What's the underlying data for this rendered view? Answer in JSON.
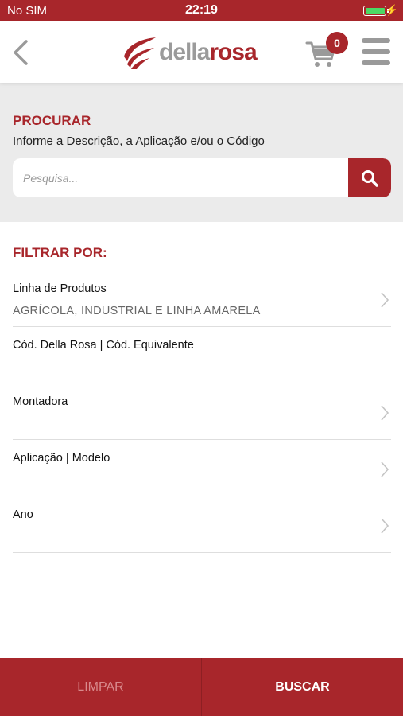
{
  "status_bar": {
    "carrier": "No SIM",
    "time": "22:19",
    "battery_level": 1.0
  },
  "header": {
    "logo_della": "della",
    "logo_rosa": "rosa",
    "cart_count": "0",
    "icons": {
      "back": "chevron-left-icon",
      "cart": "cart-icon",
      "menu": "hamburger-menu-icon"
    }
  },
  "search": {
    "title": "PROCURAR",
    "subtitle": "Informe a Descrição, a Aplicação e/ou o Código",
    "placeholder": "Pesquisa..."
  },
  "filters": {
    "title": "FILTRAR POR:",
    "items": [
      {
        "label": "Linha de Produtos",
        "value": "AGRÍCOLA, INDUSTRIAL E LINHA AMARELA",
        "has_chevron": true
      },
      {
        "label": "Cód. Della Rosa | Cód. Equivalente",
        "value": "",
        "has_chevron": false
      },
      {
        "label": "Montadora",
        "value": "",
        "has_chevron": true
      },
      {
        "label": "Aplicação | Modelo",
        "value": "",
        "has_chevron": true
      },
      {
        "label": "Ano",
        "value": "",
        "has_chevron": true
      }
    ]
  },
  "bottom_bar": {
    "clear_label": "LIMPAR",
    "search_label": "BUSCAR"
  },
  "colors": {
    "brand": "#a8262b",
    "light_gray": "#ebebeb",
    "gray": "#9b9b9b"
  }
}
